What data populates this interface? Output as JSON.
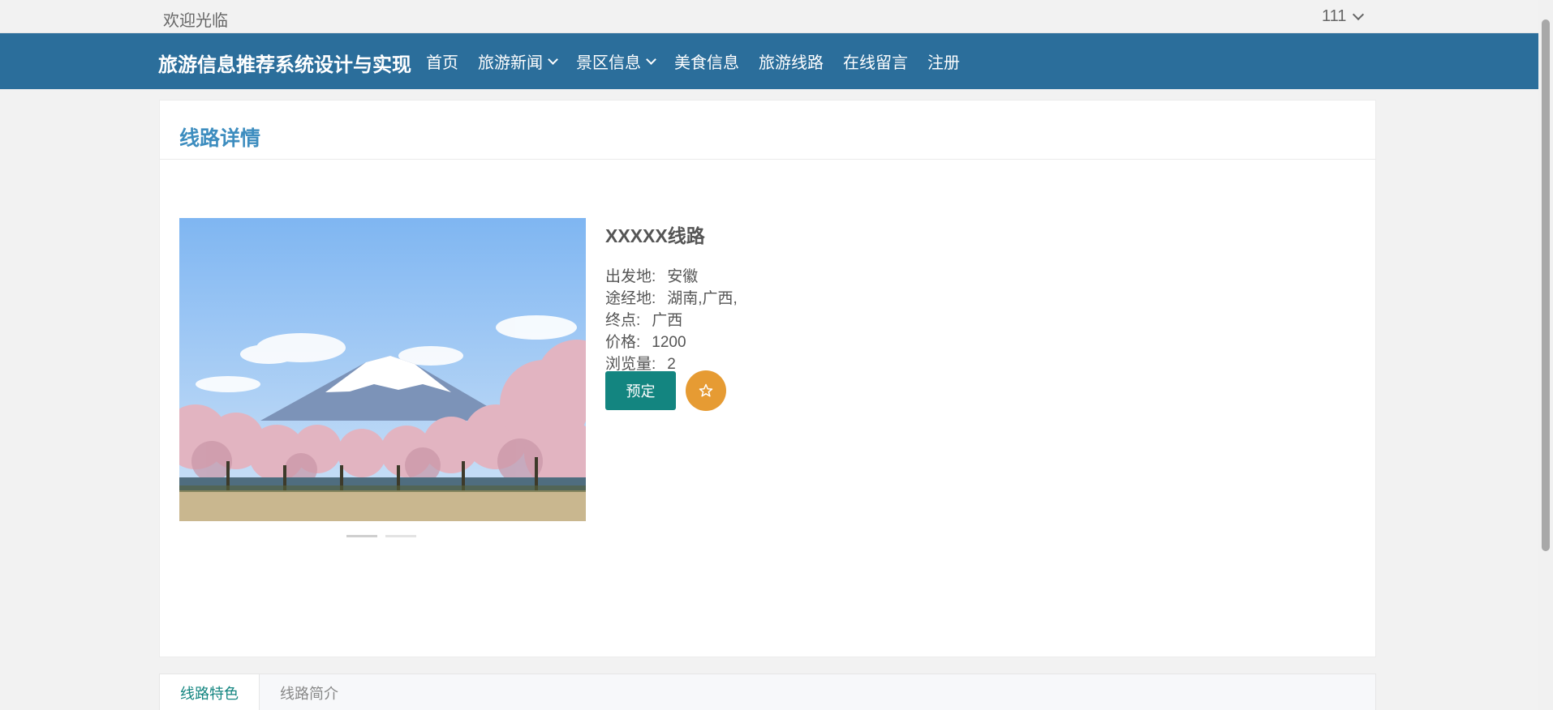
{
  "topbar": {
    "welcome": "欢迎光临",
    "username": "111"
  },
  "nav": {
    "brand": "旅游信息推荐系统设计与实现",
    "items": [
      {
        "label": "首页",
        "dropdown": false
      },
      {
        "label": "旅游新闻",
        "dropdown": true
      },
      {
        "label": "景区信息",
        "dropdown": true
      },
      {
        "label": "美食信息",
        "dropdown": false
      },
      {
        "label": "旅游线路",
        "dropdown": false
      },
      {
        "label": "在线留言",
        "dropdown": false
      },
      {
        "label": "注册",
        "dropdown": false
      }
    ]
  },
  "detail": {
    "heading": "线路详情",
    "title": "XXXXX线路",
    "fields": [
      {
        "key": "出发地:",
        "value": "安徽"
      },
      {
        "key": "途经地:",
        "value": "湖南,广西,"
      },
      {
        "key": "终点:",
        "value": "广西"
      },
      {
        "key": "价格:",
        "value": "1200"
      },
      {
        "key": "浏览量:",
        "value": "2"
      }
    ],
    "book_label": "预定",
    "carousel_count": 2,
    "carousel_active": 0
  },
  "tabs": [
    {
      "label": "线路特色",
      "active": true
    },
    {
      "label": "线路简介",
      "active": false
    }
  ],
  "icons": {
    "favorite": "star-icon",
    "dropdown": "chevron-down-icon"
  },
  "colors": {
    "nav": "#2b6e9b",
    "heading": "#3d8dbf",
    "book": "#138580",
    "favorite": "#e69b33"
  }
}
